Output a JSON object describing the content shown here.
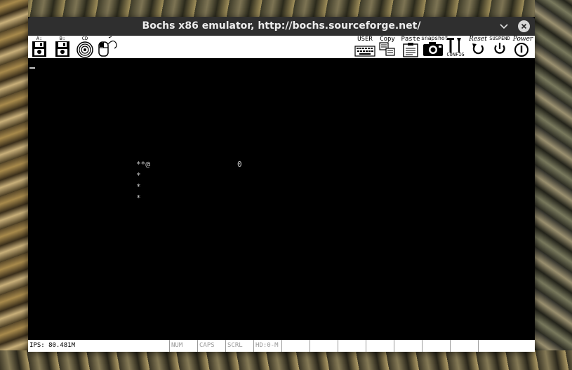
{
  "window": {
    "title": "Bochs x86 emulator, http://bochs.sourceforge.net/"
  },
  "toolbar": {
    "floppy_a_label": "A:",
    "floppy_b_label": "B:",
    "cdrom_label": "CD",
    "user_label": "USER",
    "copy_label": "Copy",
    "paste_label": "Paste",
    "snapshot_label": "snapshot",
    "config_label": "CONFIG",
    "reset_label": "Reset",
    "suspend_label": "SUSPEND",
    "power_label": "Power"
  },
  "console": {
    "snake_head_row": "**@",
    "snake_body_1": "*",
    "snake_body_2": "*",
    "snake_body_3": "*",
    "food": "0"
  },
  "statusbar": {
    "ips": "IPS: 80.481M",
    "num": "NUM",
    "caps": "CAPS",
    "scrl": "SCRL",
    "hd": "HD:0-M"
  },
  "icons": {
    "floppy_a": "floppy-icon",
    "floppy_b": "floppy-icon",
    "cdrom": "cdrom-icon",
    "mouse": "mouse-icon",
    "user": "keyboard-icon",
    "copy": "copy-icon",
    "paste": "paste-icon",
    "snapshot": "camera-icon",
    "config": "tools-icon",
    "reset": "reset-icon",
    "suspend": "suspend-icon",
    "power": "power-icon"
  }
}
